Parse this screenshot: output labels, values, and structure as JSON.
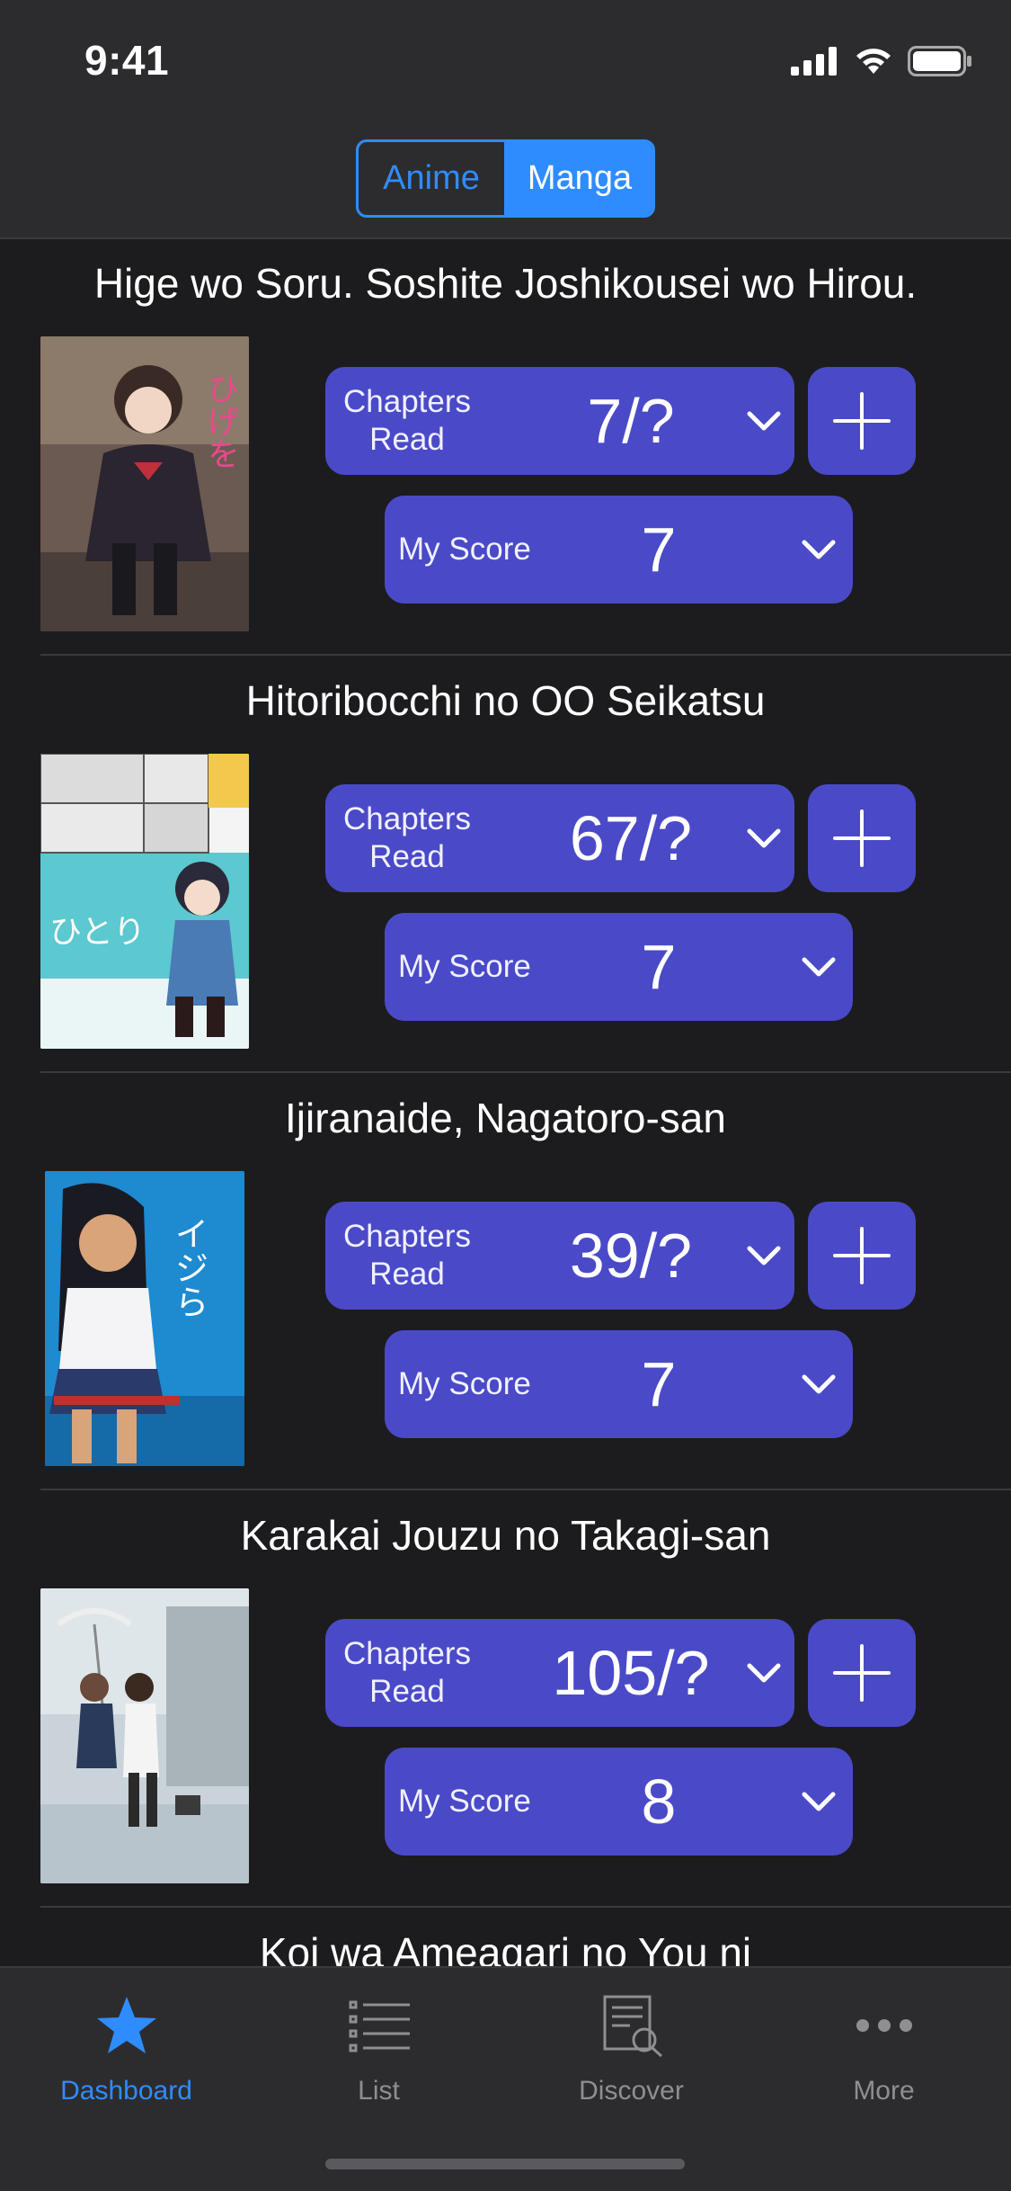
{
  "status_bar": {
    "time": "9:41"
  },
  "segmented": {
    "options": [
      "Anime",
      "Manga"
    ],
    "selected": "Manga"
  },
  "entries": [
    {
      "title": "Hige wo Soru. Soshite Joshikousei wo Hirou.",
      "chapters_label": "Chapters\nRead",
      "chapters_value": "7/?",
      "score_label": "My Score",
      "score_value": "7"
    },
    {
      "title": "Hitoribocchi no OO Seikatsu",
      "chapters_label": "Chapters\nRead",
      "chapters_value": "67/?",
      "score_label": "My Score",
      "score_value": "7"
    },
    {
      "title": "Ijiranaide, Nagatoro-san",
      "chapters_label": "Chapters\nRead",
      "chapters_value": "39/?",
      "score_label": "My Score",
      "score_value": "7"
    },
    {
      "title": "Karakai Jouzu no Takagi-san",
      "chapters_label": "Chapters\nRead",
      "chapters_value": "105/?",
      "score_label": "My Score",
      "score_value": "8"
    },
    {
      "title": "Koi wa Ameagari no You ni"
    }
  ],
  "tabs": [
    {
      "label": "Dashboard",
      "icon": "star-icon",
      "active": true
    },
    {
      "label": "List",
      "icon": "list-icon",
      "active": false
    },
    {
      "label": "Discover",
      "icon": "discover-icon",
      "active": false
    },
    {
      "label": "More",
      "icon": "more-icon",
      "active": false
    }
  ],
  "colors": {
    "accent": "#2f8cff",
    "pill": "#4a4ac8",
    "background": "#1c1c1e",
    "bar": "#2c2c2e"
  }
}
